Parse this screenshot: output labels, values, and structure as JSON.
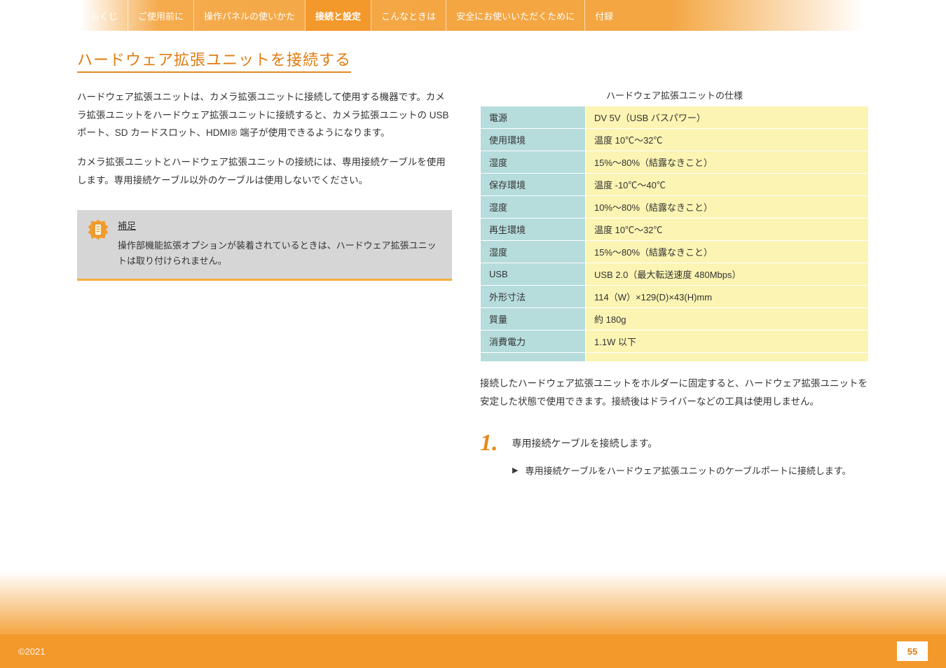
{
  "nav": {
    "tabs": [
      {
        "label": "もくじ",
        "active": false
      },
      {
        "label": "ご使用前に",
        "active": false
      },
      {
        "label": "操作パネルの使いかた",
        "active": false
      },
      {
        "label": "接続と設定",
        "active": true
      },
      {
        "label": "こんなときは",
        "active": false
      },
      {
        "label": "安全にお使いいただくために",
        "active": false
      },
      {
        "label": "付録",
        "active": false
      }
    ]
  },
  "title": "ハードウェア拡張ユニットを接続する",
  "leftCol": {
    "p1": "ハードウェア拡張ユニットは、カメラ拡張ユニットに接続して使用する機器です。カメラ拡張ユニットをハードウェア拡張ユニットに接続すると、カメラ拡張ユニットの USB ポート、SD カードスロット、HDMI® 端子が使用できるようになります。",
    "p2": "カメラ拡張ユニットとハードウェア拡張ユニットの接続には、専用接続ケーブルを使用します。専用接続ケーブル以外のケーブルは使用しないでください。"
  },
  "note": {
    "title": "補足",
    "body": "操作部機能拡張オプションが装着されているときは、ハードウェア拡張ユニットは取り付けられません。"
  },
  "specCaption": "ハードウェア拡張ユニットの仕様",
  "specs": [
    {
      "key": "電源",
      "val": "DV 5V（USB バスパワー）"
    },
    {
      "key": "使用環境",
      "val": "温度 10℃～32℃"
    },
    {
      "key": "湿度",
      "val": "15%～80%（結露なきこと）"
    },
    {
      "key": "保存環境",
      "val": "温度 -10℃～40℃"
    },
    {
      "key": "湿度",
      "val": "10%～80%（結露なきこと）"
    },
    {
      "key": "再生環境",
      "val": "温度 10℃～32℃"
    },
    {
      "key": "湿度",
      "val": "15%～80%（結露なきこと）"
    },
    {
      "key": "USB",
      "val": "USB 2.0（最大転送速度 480Mbps）"
    },
    {
      "key": "外形寸法",
      "val": "114（W）×129(D)×43(H)mm"
    },
    {
      "key": "質量",
      "val": "約 180g"
    },
    {
      "key": "消費電力",
      "val": "1.1W 以下"
    },
    {
      "key": "",
      "val": ""
    }
  ],
  "rightPara": "接続したハードウェア拡張ユニットをホルダーに固定すると、ハードウェア拡張ユニットを安定した状態で使用できます。接続後はドライバーなどの工具は使用しません。",
  "step": {
    "num": "1.",
    "text": "専用接続ケーブルを接続します。"
  },
  "triItem": "専用接続ケーブルをハードウェア拡張ユニットのケーブルポートに接続します。",
  "footer": {
    "copyright": "©2021",
    "page": "55"
  }
}
